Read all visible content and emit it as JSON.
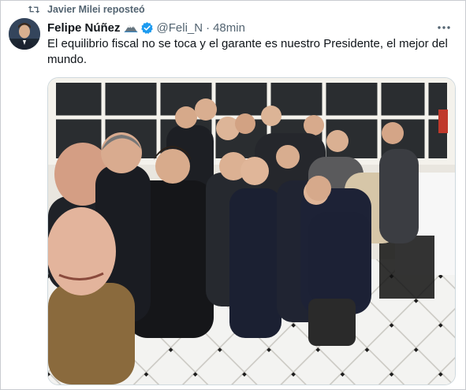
{
  "repost": {
    "icon": "repost-icon",
    "label": "Javier Milei reposteó"
  },
  "tweet": {
    "author_name": "Felipe Núñez",
    "author_emoji": "mountain-snow-emoji-icon",
    "verified_icon": "verified-badge-icon",
    "verified_color": "#1d9bf0",
    "handle": "@Feli_N",
    "separator": "·",
    "time": "48min",
    "text": "El equilibrio fiscal no se toca y el garante es nuestro Presidente, el mejor del mundo.",
    "more_icon": "more-options-icon",
    "media_description_icon": "group-photo"
  },
  "colors": {
    "text_primary": "#0f1419",
    "text_secondary": "#536471",
    "border": "#cfd9de"
  }
}
